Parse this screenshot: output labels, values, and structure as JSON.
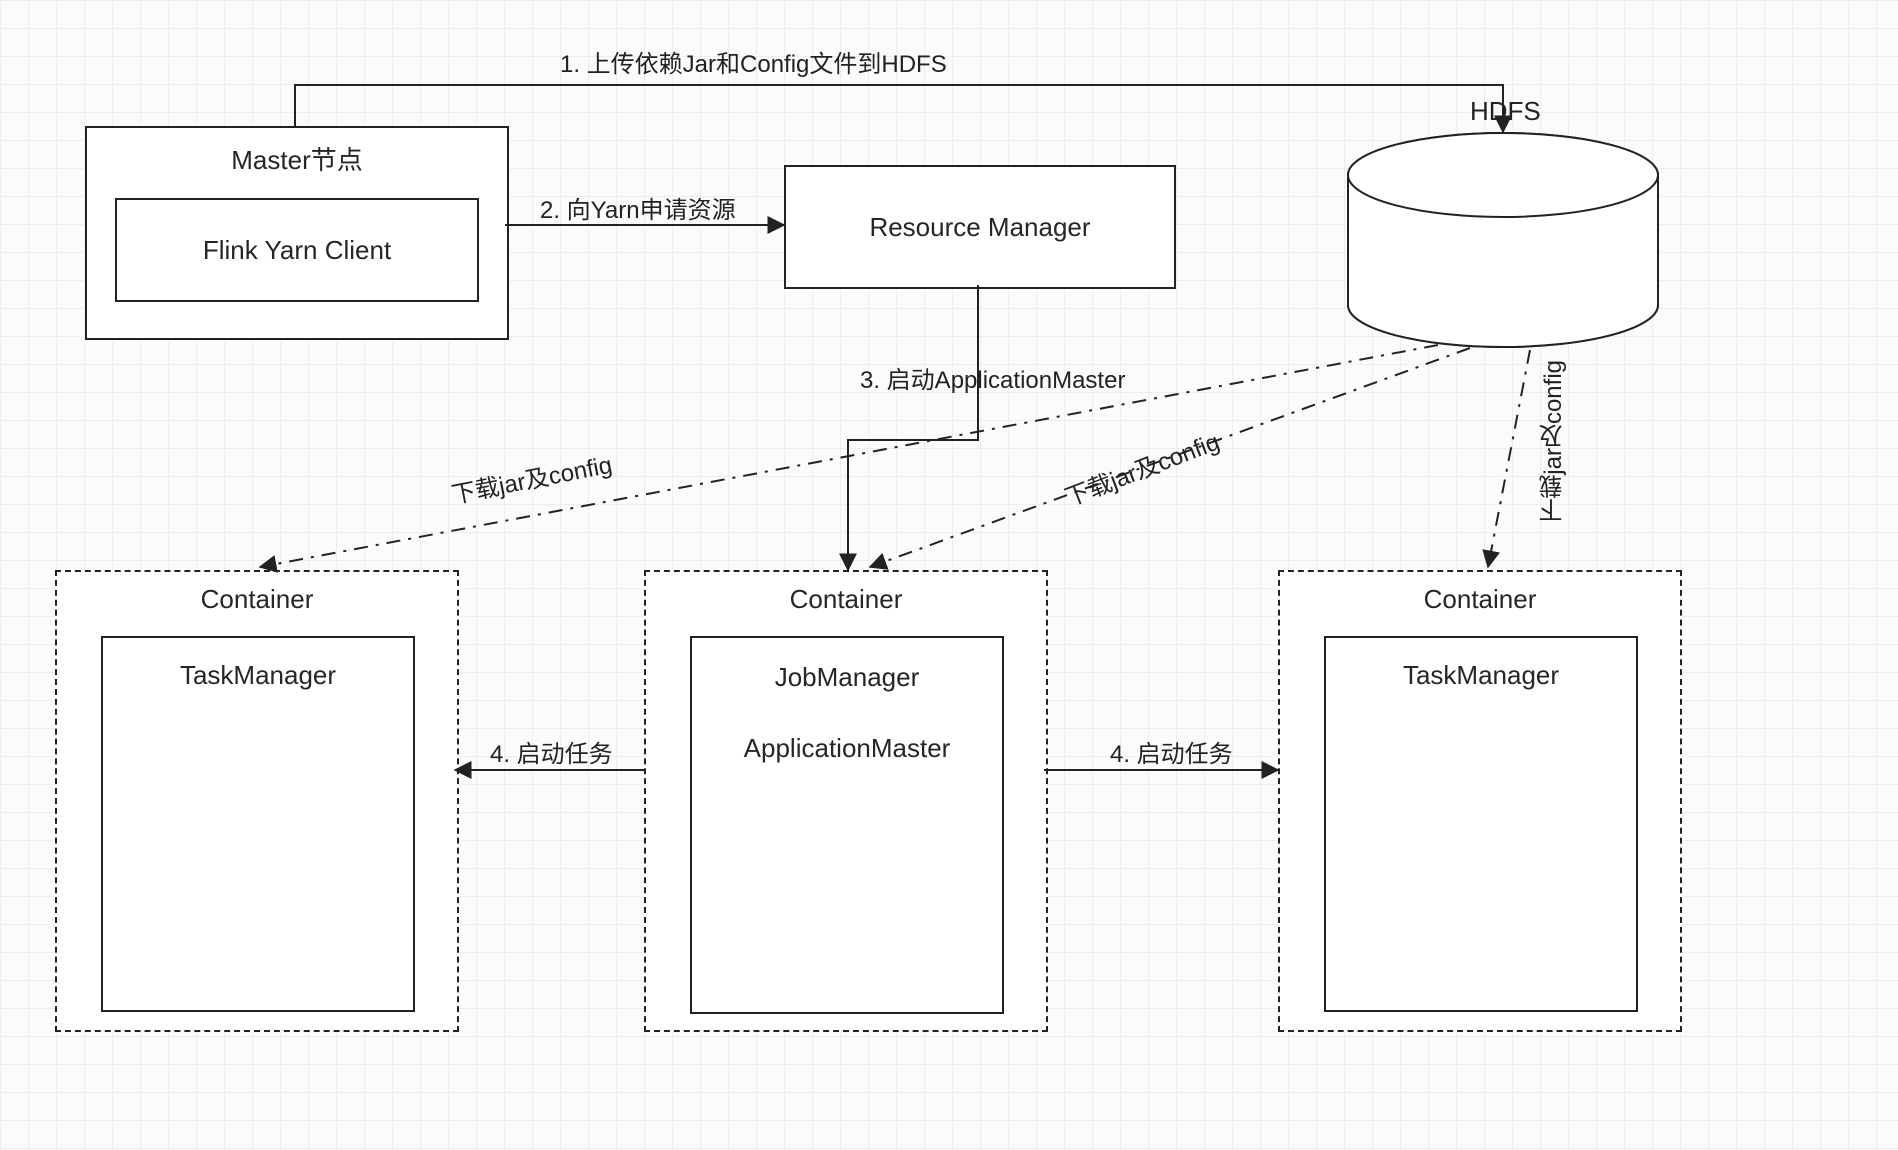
{
  "nodes": {
    "master": {
      "title": "Master节点",
      "inner": "Flink Yarn Client"
    },
    "rm": {
      "label": "Resource Manager"
    },
    "hdfs": {
      "label": "HDFS"
    },
    "container_left": {
      "title": "Container",
      "inner": "TaskManager"
    },
    "container_mid": {
      "title": "Container",
      "inner1": "JobManager",
      "inner2": "ApplicationMaster"
    },
    "container_right": {
      "title": "Container",
      "inner": "TaskManager"
    }
  },
  "edges": {
    "step1": "1. 上传依赖Jar和Config文件到HDFS",
    "step2": "2. 向Yarn申请资源",
    "step3": "3. 启动ApplicationMaster",
    "step4": "4. 启动任务",
    "download": "下载jar及config"
  }
}
